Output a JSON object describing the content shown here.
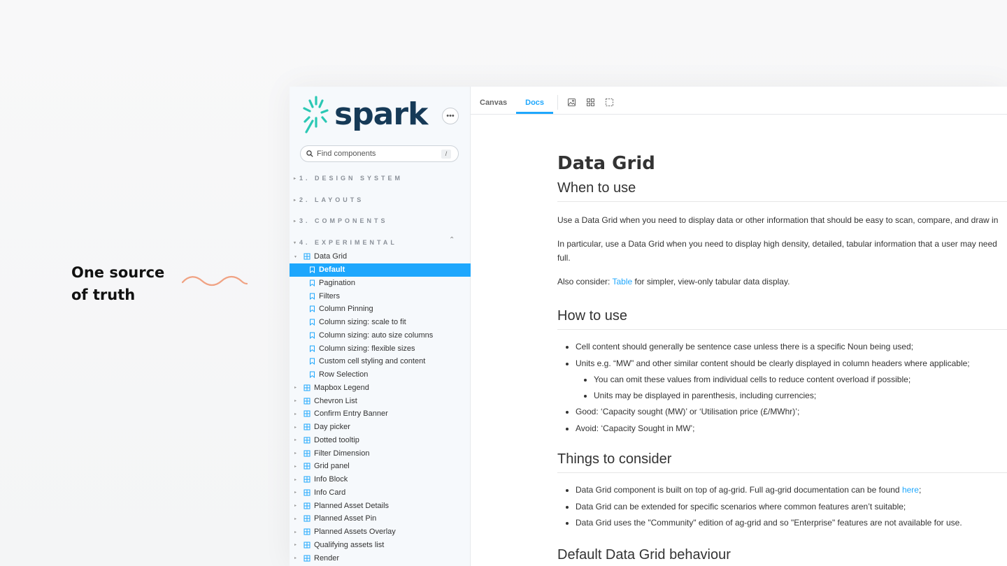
{
  "tagline": {
    "line1": "One source",
    "line2": "of truth"
  },
  "colors": {
    "accent": "#1ea7fd",
    "brand_navy": "#163a57",
    "brand_teal": "#2bc8b4",
    "wave": "#f0a283"
  },
  "sidebar": {
    "logo_text": "spark",
    "menu_label": "•••",
    "search_placeholder": "Find components",
    "search_shortcut": "/",
    "sections": [
      "1. DESIGN SYSTEM",
      "2. LAYOUTS",
      "3. COMPONENTS",
      "4. EXPERIMENTAL"
    ],
    "open_component": "Data Grid",
    "stories": [
      "Default",
      "Pagination",
      "Filters",
      "Column Pinning",
      "Column sizing: scale to fit",
      "Column sizing: auto size columns",
      "Column sizing: flexible sizes",
      "Custom cell styling and content",
      "Row Selection"
    ],
    "selected_story": "Default",
    "components": [
      "Mapbox Legend",
      "Chevron List",
      "Confirm Entry Banner",
      "Day picker",
      "Dotted tooltip",
      "Filter Dimension",
      "Grid panel",
      "Info Block",
      "Info Card",
      "Planned Asset Details",
      "Planned Asset Pin",
      "Planned Assets Overlay",
      "Qualifying assets list",
      "Render"
    ]
  },
  "toolbar": {
    "tabs": [
      "Canvas",
      "Docs"
    ],
    "active_tab": "Docs"
  },
  "doc": {
    "title": "Data Grid",
    "when_heading": "When to use",
    "when_p1": "Use a Data Grid when you need to display data or other information that should be easy to scan, compare, and draw in",
    "when_p2a": "In particular, use a Data Grid when you need to display high density, detailed, tabular information that a user may need",
    "when_p2b": "full.",
    "also_prefix": "Also consider: ",
    "also_link": "Table",
    "also_suffix": " for simpler, view-only tabular data display.",
    "how_heading": "How to use",
    "how_items": [
      "Cell content should generally be sentence case unless there is a specific Noun being used;",
      "Units e.g. “MW” and other similar content should be clearly displayed in column headers where applicable;",
      "You can omit these values from individual cells to reduce content overload if possible;",
      "Units may be displayed in parenthesis, including currencies;",
      "Good: ‘Capacity sought (MW)’ or ‘Utilisation price (£/MWhr)’;",
      "Avoid: ‘Capacity Sought in MW’;"
    ],
    "consider_heading": "Things to consider",
    "consider_1_prefix": "Data Grid component is built on top of ag-grid. Full ag-grid documentation can be found ",
    "consider_1_link": "here",
    "consider_1_suffix": ";",
    "consider_2": "Data Grid can be extended for specific scenarios where common features aren’t suitable;",
    "consider_3": "Data Grid uses the \"Community\" edition of ag-grid and so \"Enterprise\" features are not available for use.",
    "behaviour_heading": "Default Data Grid behaviour"
  }
}
